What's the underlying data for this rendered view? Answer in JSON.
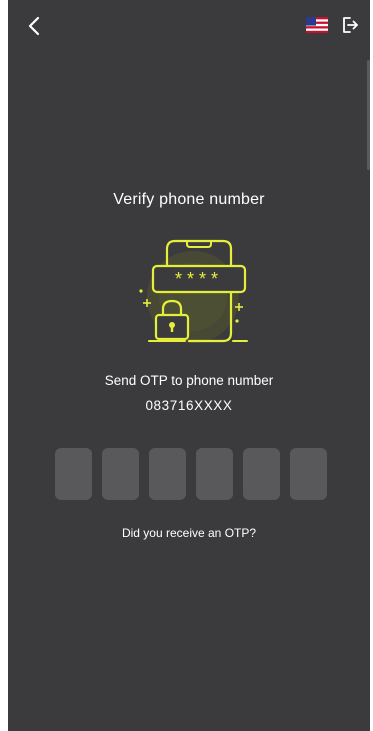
{
  "header": {
    "back_icon": "chevron-left-icon",
    "flag_icon": "us-flag-icon",
    "logout_icon": "logout-icon"
  },
  "content": {
    "title": "Verify phone number",
    "otp_asterisks": "****",
    "subtitle": "Send OTP to phone number",
    "phone_number": "083716XXXX",
    "otp_fields": [
      "",
      "",
      "",
      "",
      "",
      ""
    ],
    "resend_prompt": "Did you receive an OTP?"
  },
  "colors": {
    "background": "#3b3b3d",
    "accent": "#e6ee3c",
    "otp_box": "#59595c",
    "text": "#ffffff"
  }
}
